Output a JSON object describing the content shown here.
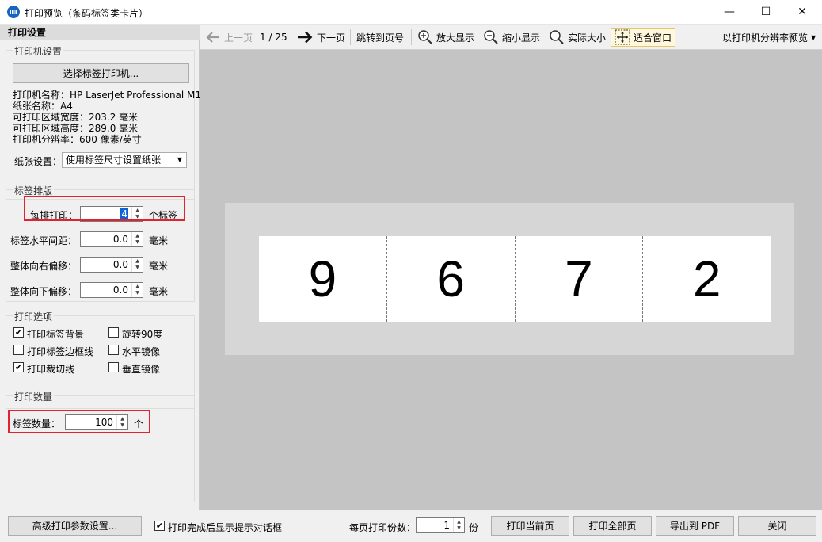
{
  "window": {
    "title": "打印预览（条码标签类卡片）",
    "minimize": "—",
    "maximize": "☐",
    "close": "✕"
  },
  "settings_panel": {
    "header": "打印设置",
    "printer_group": {
      "title": "打印机设置",
      "select_printer_button": "选择标签打印机...",
      "printer_name": "打印机名称：HP LaserJet Professional M1",
      "paper_name": "纸张名称：A4",
      "printable_width": "可打印区域宽度：203.2 毫米",
      "printable_height": "可打印区域高度：289.0 毫米",
      "resolution": "打印机分辨率：600 像素/英寸",
      "paper_setting_label": "纸张设置：",
      "paper_setting_value": "使用标签尺寸设置纸张"
    },
    "layout_group": {
      "title": "标签排版",
      "per_row_label": "每排打印：",
      "per_row_value": "4",
      "per_row_unit": "个标签",
      "h_spacing_label": "标签水平间距：",
      "h_spacing_value": "0.0",
      "h_spacing_unit": "毫米",
      "offset_right_label": "整体向右偏移：",
      "offset_right_value": "0.0",
      "offset_right_unit": "毫米",
      "offset_down_label": "整体向下偏移：",
      "offset_down_value": "0.0",
      "offset_down_unit": "毫米"
    },
    "options_group": {
      "title": "打印选项",
      "print_background": {
        "label": "打印标签背景",
        "checked": true
      },
      "rotate_90": {
        "label": "旋转90度",
        "checked": false
      },
      "print_border": {
        "label": "打印标签边框线",
        "checked": false
      },
      "mirror_horizontal": {
        "label": "水平镜像",
        "checked": false
      },
      "print_cut_line": {
        "label": "打印裁切线",
        "checked": true
      },
      "mirror_vertical": {
        "label": "垂直镜像",
        "checked": false
      }
    },
    "quantity_group": {
      "title": "打印数量",
      "label": "标签数量：",
      "value": "100",
      "unit": "个"
    }
  },
  "toolbar": {
    "prev_page": "上一页",
    "page_indicator": "1 / 25",
    "next_page": "下一页",
    "goto_page": "跳转到页号",
    "zoom_in": "放大显示",
    "zoom_out": "缩小显示",
    "actual_size": "实际大小",
    "fit_window": "适合窗口",
    "preview_mode": "以打印机分辨率预览"
  },
  "preview": {
    "labels": [
      "9",
      "6",
      "7",
      "2"
    ]
  },
  "bottom": {
    "advanced_button": "高级打印参数设置...",
    "show_dialog_label": "打印完成后显示提示对话框",
    "show_dialog_checked": true,
    "copies_label": "每页打印份数：",
    "copies_value": "1",
    "copies_unit": "份",
    "print_current": "打印当前页",
    "print_all": "打印全部页",
    "export_pdf": "导出到 PDF",
    "close": "关闭"
  },
  "colors": {
    "highlight": "#e0242f",
    "canvas_bg": "#c4c4c4",
    "sheet_bg": "#d6d6d6",
    "active_tool_bg": "#fff8dc"
  }
}
